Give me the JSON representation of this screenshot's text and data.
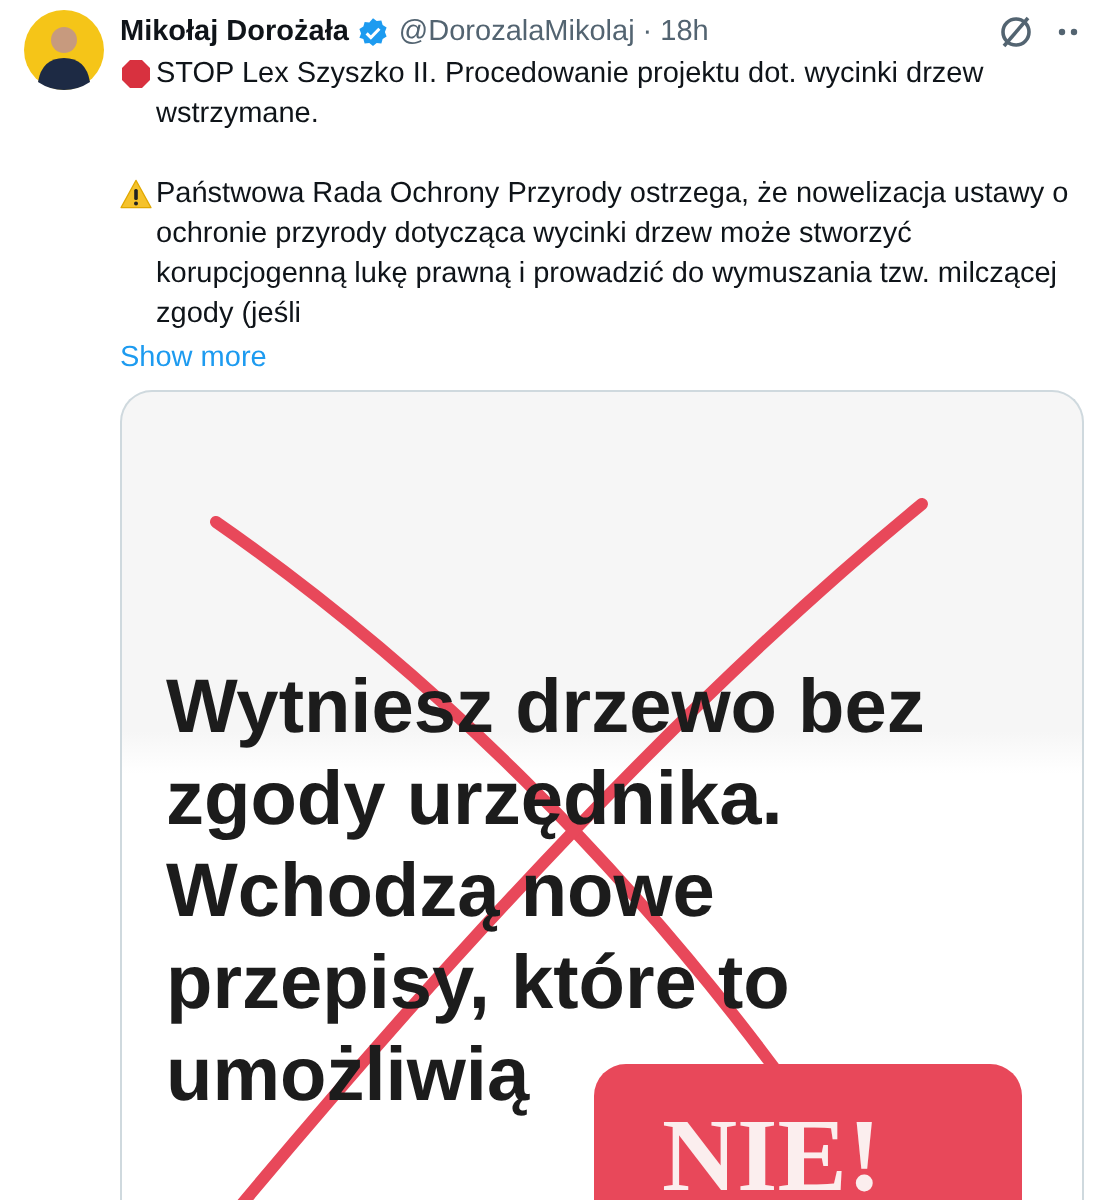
{
  "author": {
    "name": "Mikołaj Dorożała",
    "verified": true,
    "handle": "@DorozalaMikolaj",
    "separator": "·",
    "time": "18h"
  },
  "paragraphs": [
    {
      "kind": "stop",
      "text": "STOP Lex Szyszko II. Procedowanie projektu dot. wycinki drzew wstrzymane."
    },
    {
      "kind": "warning",
      "text": "Państwowa Rada Ochrony Przyrody ostrzega, że nowelizacja ustawy o ochronie przyrody dotycząca wycinki drzew może stworzyć korupcjogenną lukę prawną i prowadzić do wymuszania tzw. milczącej zgody (jeśli"
    }
  ],
  "show_more": "Show more",
  "media": {
    "lines": [
      "Wytniesz drzewo bez",
      "zgody urzędnika.",
      "Wchodzą nowe",
      "przepisy, które to",
      "umożliwią"
    ],
    "crossed_out": true,
    "stamp": "NIE!"
  }
}
